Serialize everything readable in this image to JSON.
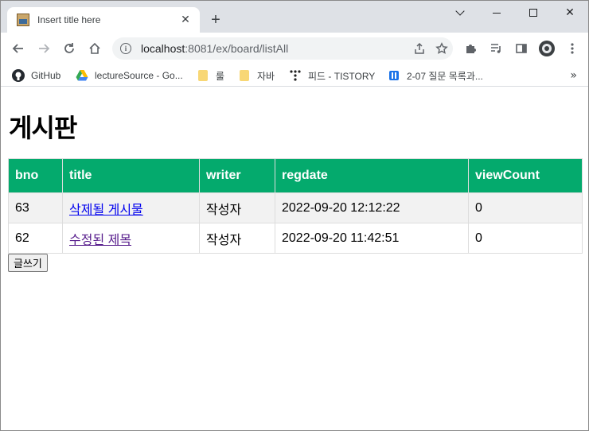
{
  "browser": {
    "tab_title": "Insert title here",
    "url_host": "localhost",
    "url_path": ":8081/ex/board/listAll",
    "bookmarks": [
      {
        "label": "GitHub"
      },
      {
        "label": "lectureSource - Go..."
      },
      {
        "label": "룰"
      },
      {
        "label": "자바"
      },
      {
        "label": "피드 - TISTORY"
      },
      {
        "label": "2-07 질문 목록과..."
      }
    ],
    "more_label": "»"
  },
  "page": {
    "heading": "게시판",
    "table": {
      "headers": [
        "bno",
        "title",
        "writer",
        "regdate",
        "viewCount"
      ],
      "rows": [
        {
          "bno": "63",
          "title": "삭제될 게시물",
          "writer": "작성자",
          "regdate": "2022-09-20 12:12:22",
          "viewCount": "0"
        },
        {
          "bno": "62",
          "title": "수정된 제목",
          "writer": "작성자",
          "regdate": "2022-09-20 11:42:51",
          "viewCount": "0"
        }
      ]
    },
    "write_button": "글쓰기"
  },
  "colors": {
    "header_bg": "#04aa6d",
    "row_alt_bg": "#f2f2f2"
  }
}
